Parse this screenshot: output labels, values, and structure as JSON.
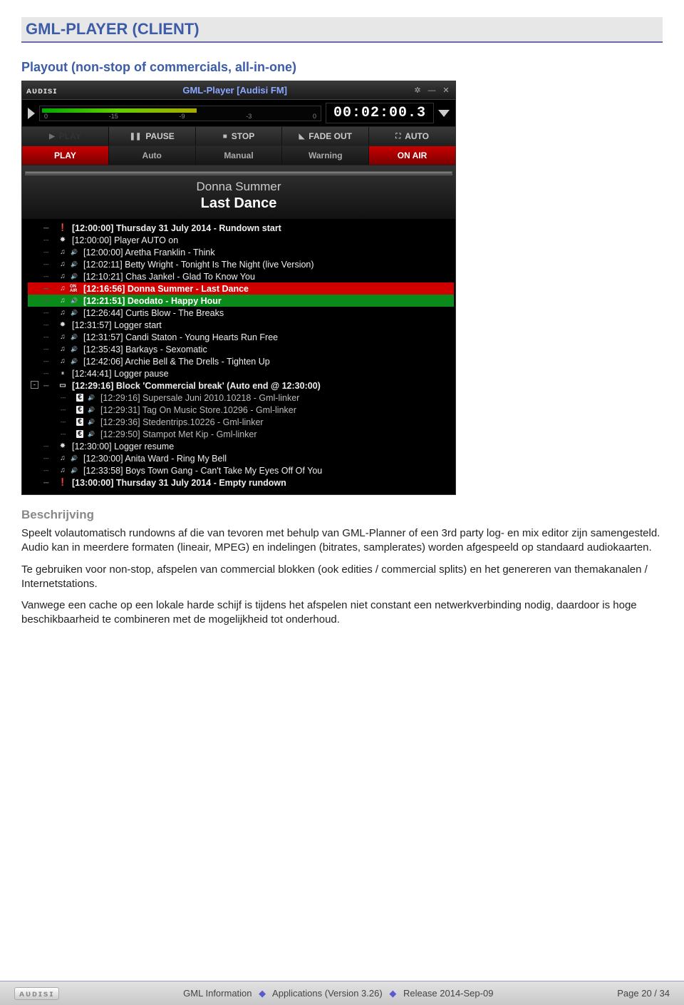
{
  "doc": {
    "title": "GML-PLAYER (CLIENT)",
    "subtitle": "Playout (non-stop of commercials, all-in-one)",
    "section_heading": "Beschrijving",
    "para1": "Speelt volautomatisch rundowns af die van tevoren met behulp van GML-Planner of een 3rd party log- en mix editor zijn samengesteld. Audio kan in meerdere formaten (lineair, MPEG) en indelingen (bitrates, samplerates) worden afgespeeld op standaard audiokaarten.",
    "para2": "Te gebruiken voor non-stop, afspelen van commercial blokken (ook edities / commercial splits) en het genereren van themakanalen / Internetstations.",
    "para3": "Vanwege een cache op een lokale harde schijf is tijdens het afspelen niet constant een netwerkverbinding nodig, daardoor is hoge beschikbaarheid te combineren met de mogelijkheid tot onderhoud."
  },
  "player": {
    "logo": "ᴀᴜᴅɪsɪ",
    "window_title": "GML-Player [Audisi FM]",
    "meter_ticks": [
      "0",
      "-15",
      "-9",
      "-3",
      "0"
    ],
    "timecode": "00:02:00.3",
    "transport": {
      "play": "PLAY",
      "pause": "PAUSE",
      "stop": "STOP",
      "fadeout": "FADE OUT",
      "auto": "AUTO"
    },
    "status": {
      "play": "PLAY",
      "auto": "Auto",
      "manual": "Manual",
      "warning": "Warning",
      "onair": "ON AIR"
    },
    "now_playing": {
      "artist": "Donna Summer",
      "track": "Last Dance"
    },
    "rundown": [
      {
        "k": "hdr",
        "bold": true,
        "icons": [
          "bang"
        ],
        "text": "[12:00:00] Thursday 31 July 2014 - Rundown start"
      },
      {
        "k": "sys",
        "icons": [
          "gear"
        ],
        "text": "[12:00:00] Player AUTO on"
      },
      {
        "k": "song",
        "icons": [
          "note",
          "spk"
        ],
        "text": "[12:00:00] Aretha Franklin - Think"
      },
      {
        "k": "song",
        "icons": [
          "note",
          "spk"
        ],
        "text": "[12:02:11] Betty Wright - Tonight Is The Night (live Version)"
      },
      {
        "k": "song",
        "icons": [
          "note",
          "spk"
        ],
        "text": "[12:10:21] Chas Jankel - Glad To Know You"
      },
      {
        "k": "song",
        "red": true,
        "icons": [
          "note",
          "onair"
        ],
        "text": "[12:16:56] Donna Summer - Last Dance"
      },
      {
        "k": "song",
        "green": true,
        "icons": [
          "note",
          "spk"
        ],
        "text": "[12:21:51] Deodato - Happy Hour"
      },
      {
        "k": "song",
        "icons": [
          "note",
          "spk"
        ],
        "text": "[12:26:44] Curtis Blow - The Breaks"
      },
      {
        "k": "sys",
        "icons": [
          "gear"
        ],
        "text": "[12:31:57] Logger start"
      },
      {
        "k": "song",
        "icons": [
          "note",
          "spk"
        ],
        "text": "[12:31:57] Candi Staton - Young Hearts Run Free"
      },
      {
        "k": "song",
        "icons": [
          "note",
          "spk"
        ],
        "text": "[12:35:43] Barkays - Sexomatic"
      },
      {
        "k": "song",
        "icons": [
          "note",
          "spk"
        ],
        "text": "[12:42:06] Archie Bell & The Drells - Tighten Up"
      },
      {
        "k": "sys",
        "icons": [
          "pause"
        ],
        "text": "[12:44:41] Logger pause"
      },
      {
        "k": "block",
        "bold": true,
        "expander": "-",
        "icons": [
          "block"
        ],
        "text": "[12:29:16] Block 'Commercial break' (Auto end @ 12:30:00)"
      },
      {
        "k": "ad",
        "gray": true,
        "indent": 2,
        "icons": [
          "euro",
          "spk"
        ],
        "text": "[12:29:16] Supersale Juni 2010.10218 - Gml-linker"
      },
      {
        "k": "ad",
        "gray": true,
        "indent": 2,
        "icons": [
          "euro",
          "spk"
        ],
        "text": "[12:29:31] Tag On Music Store.10296 - Gml-linker"
      },
      {
        "k": "ad",
        "gray": true,
        "indent": 2,
        "icons": [
          "euro",
          "spk"
        ],
        "text": "[12:29:36] Stedentrips.10226 - Gml-linker"
      },
      {
        "k": "ad",
        "gray": true,
        "indent": 2,
        "icons": [
          "euro",
          "spk"
        ],
        "text": "[12:29:50] Stampot Met Kip - Gml-linker"
      },
      {
        "k": "sys",
        "icons": [
          "gear"
        ],
        "text": "[12:30:00] Logger resume"
      },
      {
        "k": "song",
        "icons": [
          "note",
          "spk"
        ],
        "text": "[12:30:00] Anita Ward - Ring My Bell"
      },
      {
        "k": "song",
        "icons": [
          "note",
          "spk"
        ],
        "text": "[12:33:58] Boys Town Gang - Can't Take My Eyes Off Of You"
      },
      {
        "k": "hdr",
        "bold": true,
        "icons": [
          "bang"
        ],
        "text": "[13:00:00] Thursday 31 July 2014 - Empty rundown"
      }
    ]
  },
  "footer": {
    "logo": "ᴀᴜᴅɪsɪ",
    "info_label": "GML Information",
    "apps_label": "Applications (Version 3.26)",
    "release_label": "Release 2014-Sep-09",
    "page_label": "Page 20 / 34"
  }
}
